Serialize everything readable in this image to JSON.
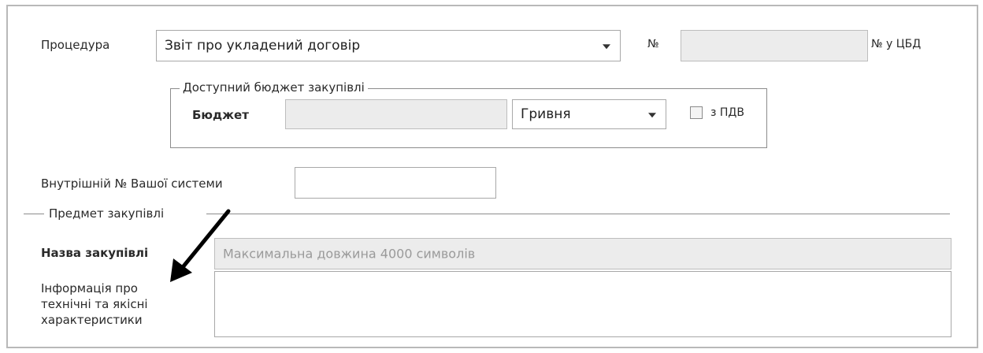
{
  "form": {
    "procedure_label": "Процедура",
    "procedure_value": "Звіт про укладений договір",
    "number_label": "№",
    "number_value": "",
    "cbd_number_label": "№ у ЦБД",
    "budget_group_legend": "Доступний бюджет закупівлі",
    "budget_label": "Бюджет",
    "budget_value": "",
    "currency_value": "Гривня",
    "vat_label": "з ПДВ",
    "vat_checked": false,
    "internal_number_label": "Внутрішній № Вашої системи",
    "internal_number_value": "",
    "subject_group_legend": "Предмет закупівлі",
    "purchase_name_label": "Назва закупівлі",
    "purchase_name_placeholder": "Максимальна довжина 4000 символів",
    "tech_info_label": "Інформація про технічні та якісні характеристики",
    "tech_info_value": ""
  },
  "icons": {
    "select_caret": "chevron-down-icon",
    "annotation_arrow": "arrow-icon"
  }
}
